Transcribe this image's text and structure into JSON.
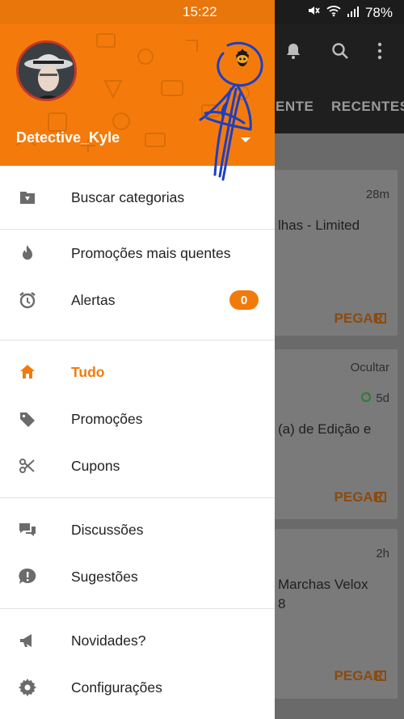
{
  "status_bar": {
    "time": "15:22",
    "battery": "78%"
  },
  "drawer": {
    "username": "Detective_Kyle",
    "menu": {
      "buscar_categorias": "Buscar categorias",
      "promocoes_quentes": "Promoções mais quentes",
      "alertas": "Alertas",
      "alertas_badge": "0",
      "tudo": "Tudo",
      "promocoes": "Promoções",
      "cupons": "Cupons",
      "discussoes": "Discussões",
      "sugestoes": "Sugestões",
      "novidades": "Novidades?",
      "configuracoes": "Configurações"
    }
  },
  "background": {
    "tab_partial": "ENTE",
    "tab_recentes": "RECENTES",
    "cards": [
      {
        "time": "28m",
        "title": "lhas - Limited",
        "cta": "PEGAR"
      },
      {
        "hide": "Ocultar",
        "time": "5d",
        "title": "(a) de Edição e",
        "cta": "PEGAR"
      },
      {
        "time": "2h",
        "title": "Marchas Velox",
        "title2": "8",
        "cta": "PEGAR"
      }
    ]
  },
  "colors": {
    "brand": "#F47B0B",
    "status_bar": "#E8760A",
    "text": "#222222"
  }
}
